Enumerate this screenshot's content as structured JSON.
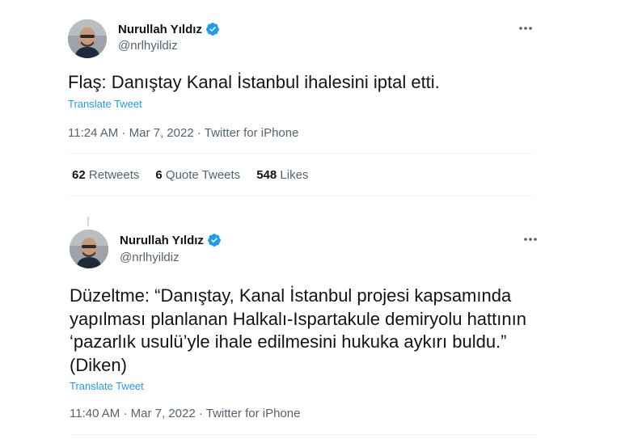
{
  "tweets": [
    {
      "author_name": "Nurullah Yıldız",
      "handle": "@nrlhyildiz",
      "text": "Flaş: Danıştay Kanal İstanbul ihalesini iptal etti.",
      "translate": "Translate Tweet",
      "time": "11:24 AM",
      "date": "Mar 7, 2022",
      "separator": "·",
      "source": "Twitter for iPhone",
      "stats": {
        "retweets_count": "62",
        "retweets_label": "Retweets",
        "quotes_count": "6",
        "quotes_label": "Quote Tweets",
        "likes_count": "548",
        "likes_label": "Likes"
      }
    },
    {
      "author_name": "Nurullah Yıldız",
      "handle": "@nrlhyildiz",
      "text": "Düzeltme: “Danıştay, Kanal İstanbul projesi kapsamında yapılması planlanan Halkalı-Ispartakule demiryolu hattının ‘pazarlık usulü’yle ihale edilmesini hukuka aykırı buldu.” (Diken)",
      "translate": "Translate Tweet",
      "time": "11:40 AM",
      "date": "Mar 7, 2022",
      "separator": "·",
      "source": "Twitter for iPhone"
    }
  ],
  "colors": {
    "verified": "#1d9bf0",
    "link": "#1d9bf0",
    "secondary_text": "#536471",
    "primary_text": "#0f1419"
  },
  "icons": {
    "verified": "verified-badge-icon",
    "more": "more-options-icon"
  }
}
